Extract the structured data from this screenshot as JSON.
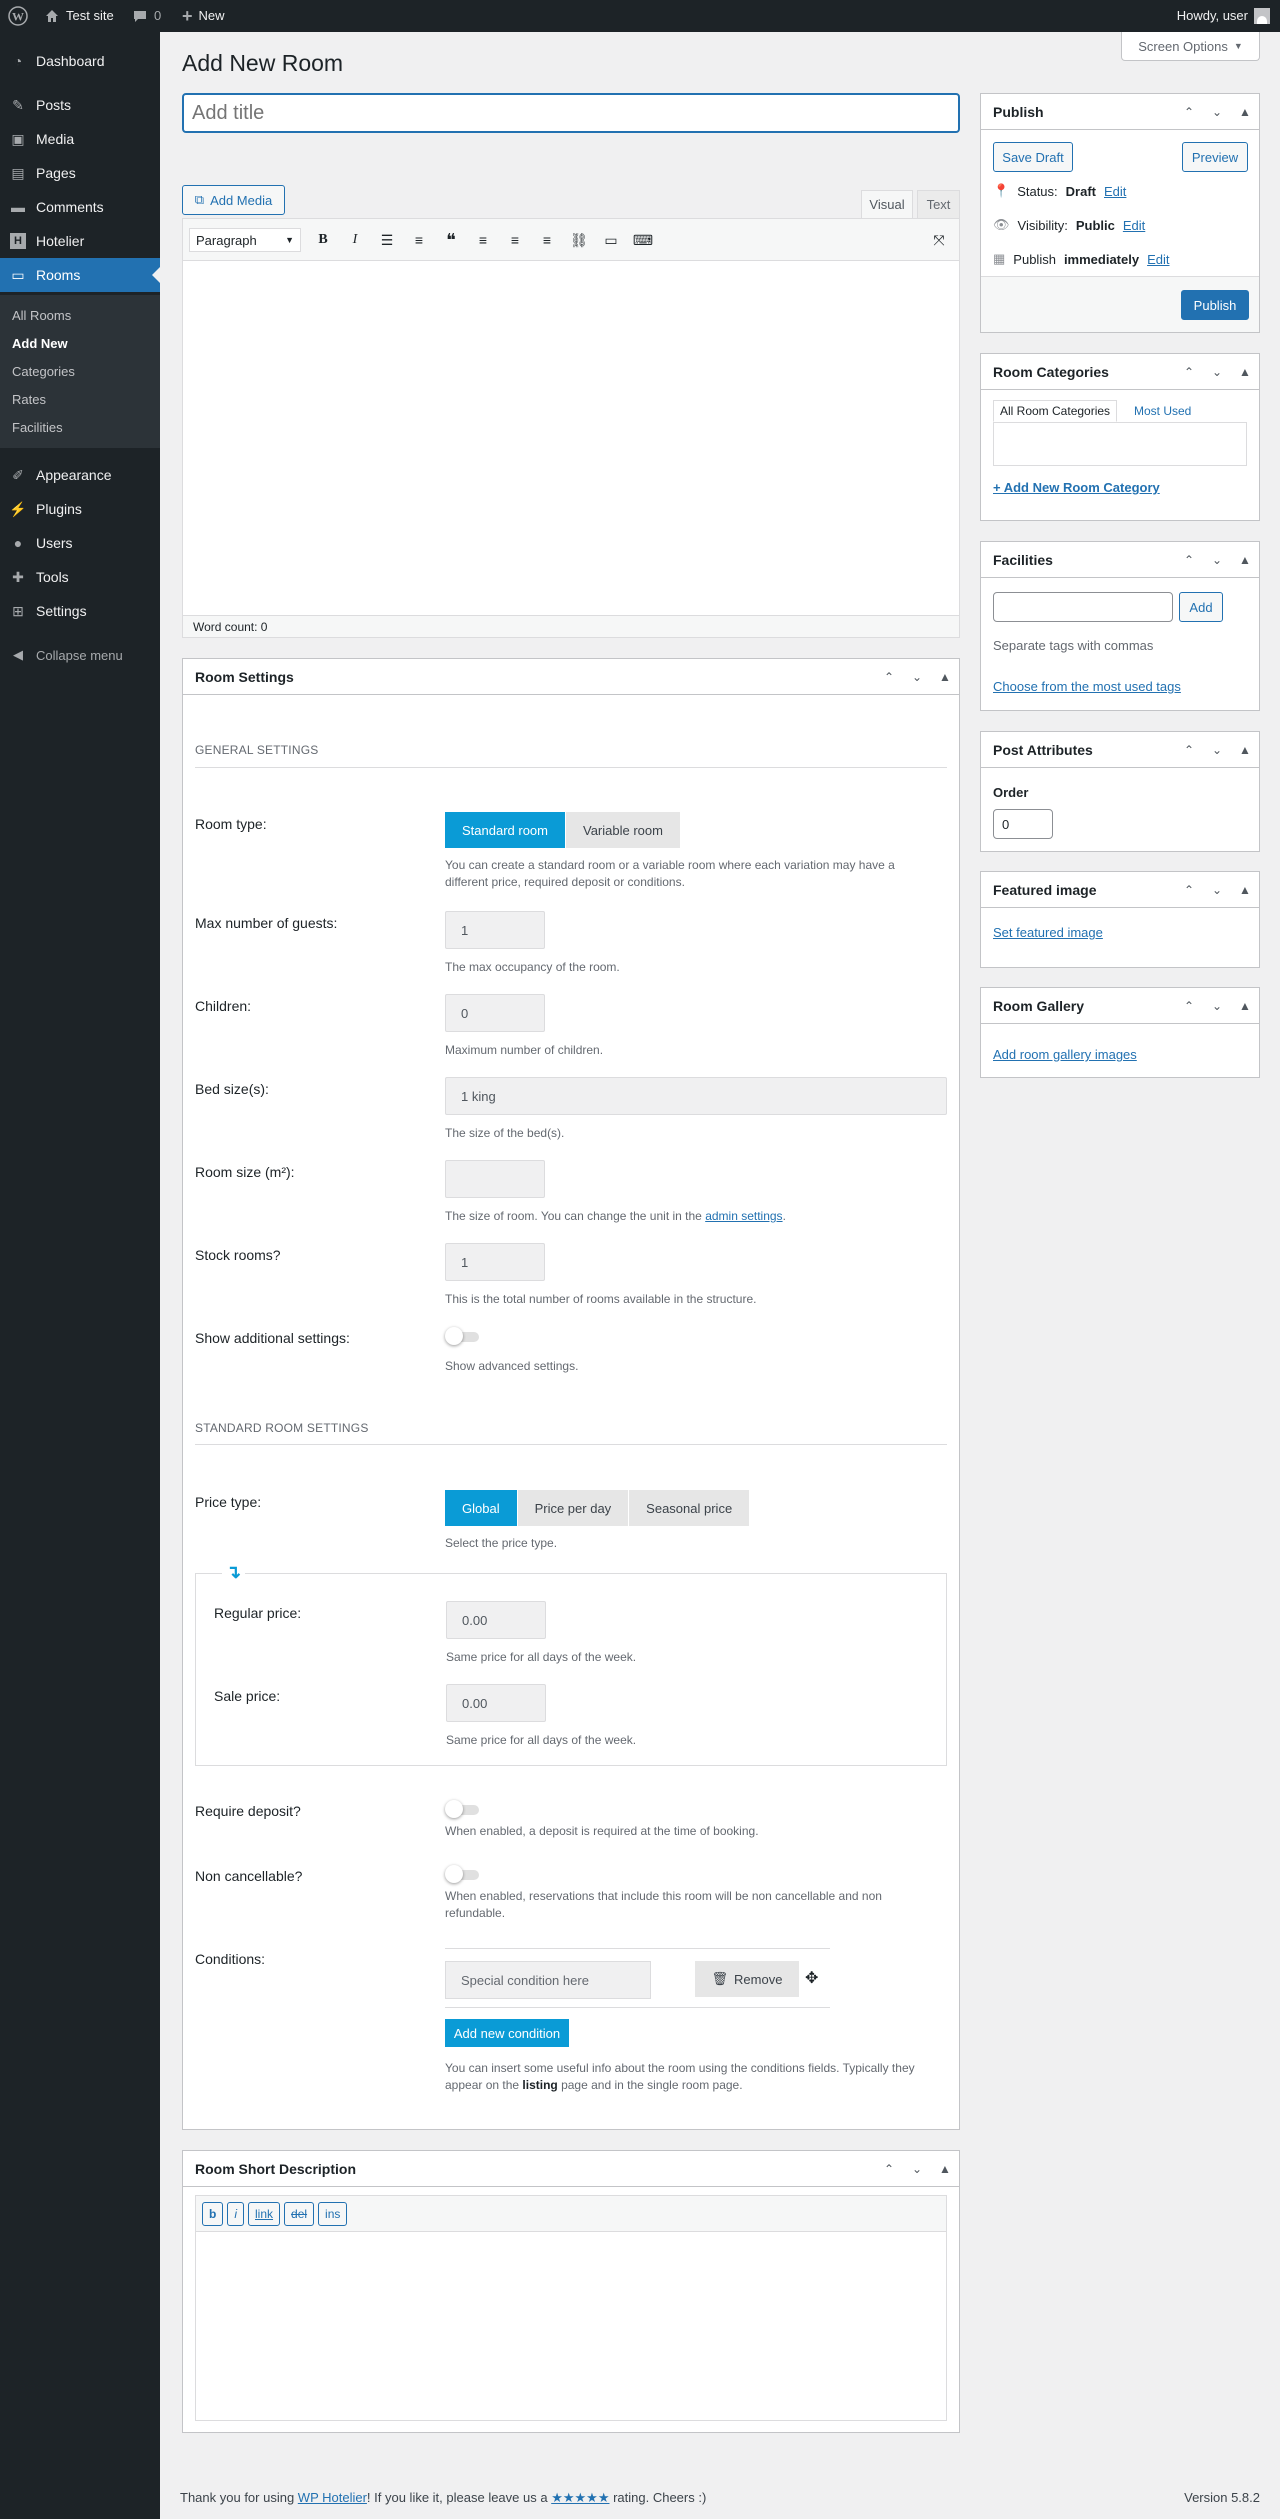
{
  "adminbar": {
    "site_name": "Test site",
    "comments_count": "0",
    "new_label": "New",
    "howdy": "Howdy, user"
  },
  "menu": {
    "items": [
      "Dashboard",
      "Posts",
      "Media",
      "Pages",
      "Comments",
      "Hotelier",
      "Rooms",
      "Appearance",
      "Plugins",
      "Users",
      "Tools",
      "Settings",
      "Collapse menu"
    ],
    "submenu": [
      "All Rooms",
      "Add New",
      "Categories",
      "Rates",
      "Facilities"
    ]
  },
  "screen_options": "Screen Options",
  "page_title": "Add New Room",
  "title_placeholder": "Add title",
  "editor": {
    "add_media": "Add Media",
    "tab_visual": "Visual",
    "tab_text": "Text",
    "format_select": "Paragraph",
    "word_count": "Word count: 0"
  },
  "room_settings": {
    "title": "Room Settings",
    "general_heading": "GENERAL SETTINGS",
    "room_type_label": "Room type:",
    "room_type_options": [
      "Standard room",
      "Variable room"
    ],
    "room_type_selected": "Standard room",
    "room_type_desc": "You can create a standard room or a variable room where each variation may have a different price, required deposit or conditions.",
    "max_guests_label": "Max number of guests:",
    "max_guests_value": "1",
    "max_guests_desc": "The max occupancy of the room.",
    "children_label": "Children:",
    "children_value": "0",
    "children_desc": "Maximum number of children.",
    "bed_label": "Bed size(s):",
    "bed_value": "1 king",
    "bed_desc": "The size of the bed(s).",
    "room_size_label": "Room size (m²):",
    "room_size_value": "",
    "room_size_desc_pre": "The size of room. You can change the unit in the ",
    "room_size_desc_link": "admin settings",
    "room_size_desc_post": ".",
    "stock_label": "Stock rooms?",
    "stock_value": "1",
    "stock_desc": "This is the total number of rooms available in the structure.",
    "additional_label": "Show additional settings:",
    "additional_desc": "Show advanced settings.",
    "standard_heading": "STANDARD ROOM SETTINGS",
    "price_type_label": "Price type:",
    "price_type_options": [
      "Global",
      "Price per day",
      "Seasonal price"
    ],
    "price_type_desc": "Select the price type.",
    "regular_price_label": "Regular price:",
    "regular_price_value": "0.00",
    "regular_price_desc": "Same price for all days of the week.",
    "sale_price_label": "Sale price:",
    "sale_price_value": "0.00",
    "sale_price_desc": "Same price for all days of the week.",
    "deposit_label": "Require deposit?",
    "deposit_desc": "When enabled, a deposit is required at the time of booking.",
    "noncancel_label": "Non cancellable?",
    "noncancel_desc": "When enabled, reservations that include this room will be non cancellable and non refundable.",
    "conditions_label": "Conditions:",
    "condition_placeholder": "Special condition here",
    "remove_label": "Remove",
    "add_condition": "Add new condition",
    "conditions_desc_pre": "You can insert some useful info about the room using the conditions fields. Typically they appear on the ",
    "conditions_desc_bold": "listing",
    "conditions_desc_post": " page and in the single room page."
  },
  "short_desc": {
    "title": "Room Short Description",
    "qt_buttons": [
      "b",
      "i",
      "link",
      "del",
      "ins"
    ]
  },
  "publish": {
    "title": "Publish",
    "save_draft": "Save Draft",
    "preview": "Preview",
    "status_label": "Status:",
    "status_value": "Draft",
    "visibility_label": "Visibility:",
    "visibility_value": "Public",
    "publish_label": "Publish",
    "publish_when": "immediately",
    "edit": "Edit",
    "publish_button": "Publish"
  },
  "categories": {
    "title": "Room Categories",
    "tab_all": "All Room Categories",
    "tab_most": "Most Used",
    "add_new": "+ Add New Room Category"
  },
  "facilities": {
    "title": "Facilities",
    "add": "Add",
    "hint": "Separate tags with commas",
    "choose": "Choose from the most used tags"
  },
  "attributes": {
    "title": "Post Attributes",
    "order_label": "Order",
    "order_value": "0"
  },
  "featured": {
    "title": "Featured image",
    "link": "Set featured image"
  },
  "gallery": {
    "title": "Room Gallery",
    "link": "Add room gallery images"
  },
  "footer": {
    "thanks_pre": "Thank you for using ",
    "thanks_link": "WP Hotelier",
    "thanks_mid": "! If you like it, please leave us a ",
    "stars": "★★★★★",
    "thanks_post": " rating. Cheers :)",
    "version": "Version 5.8.2"
  },
  "colors": {
    "accent": "#2271b1",
    "segment_active": "#0a9bd6",
    "adminbar": "#1d2327"
  }
}
